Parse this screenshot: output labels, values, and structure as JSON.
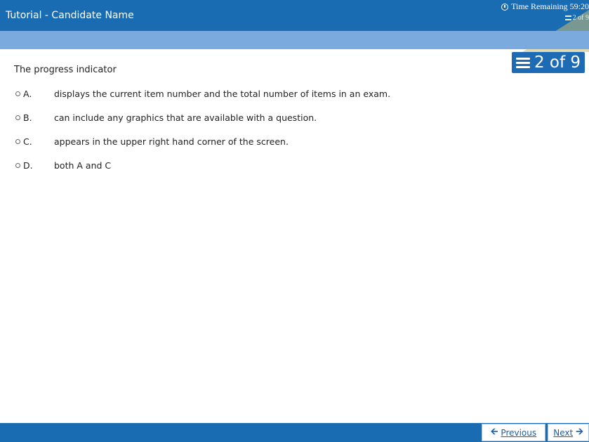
{
  "header": {
    "title": "Tutorial - Candidate Name",
    "timer_text": "Time Remaining 59:20",
    "mini_progress": "2 of 9"
  },
  "progress": {
    "text": "2 of 9",
    "current": 2,
    "total": 9
  },
  "question": {
    "stem": "The progress indicator",
    "options": [
      {
        "letter": "A.",
        "text": "displays the current item number and the total number of items in an exam."
      },
      {
        "letter": "B.",
        "text": "can include any graphics that are available with a question."
      },
      {
        "letter": "C.",
        "text": "appears in the upper right hand corner of the screen."
      },
      {
        "letter": "D.",
        "text": "both A and C"
      }
    ]
  },
  "footer": {
    "previous_label": "Previous",
    "next_label": "Next"
  },
  "colors": {
    "header": "#1a6cb2",
    "sub_bar": "#7aaade",
    "badge": "#1e6bb5"
  }
}
